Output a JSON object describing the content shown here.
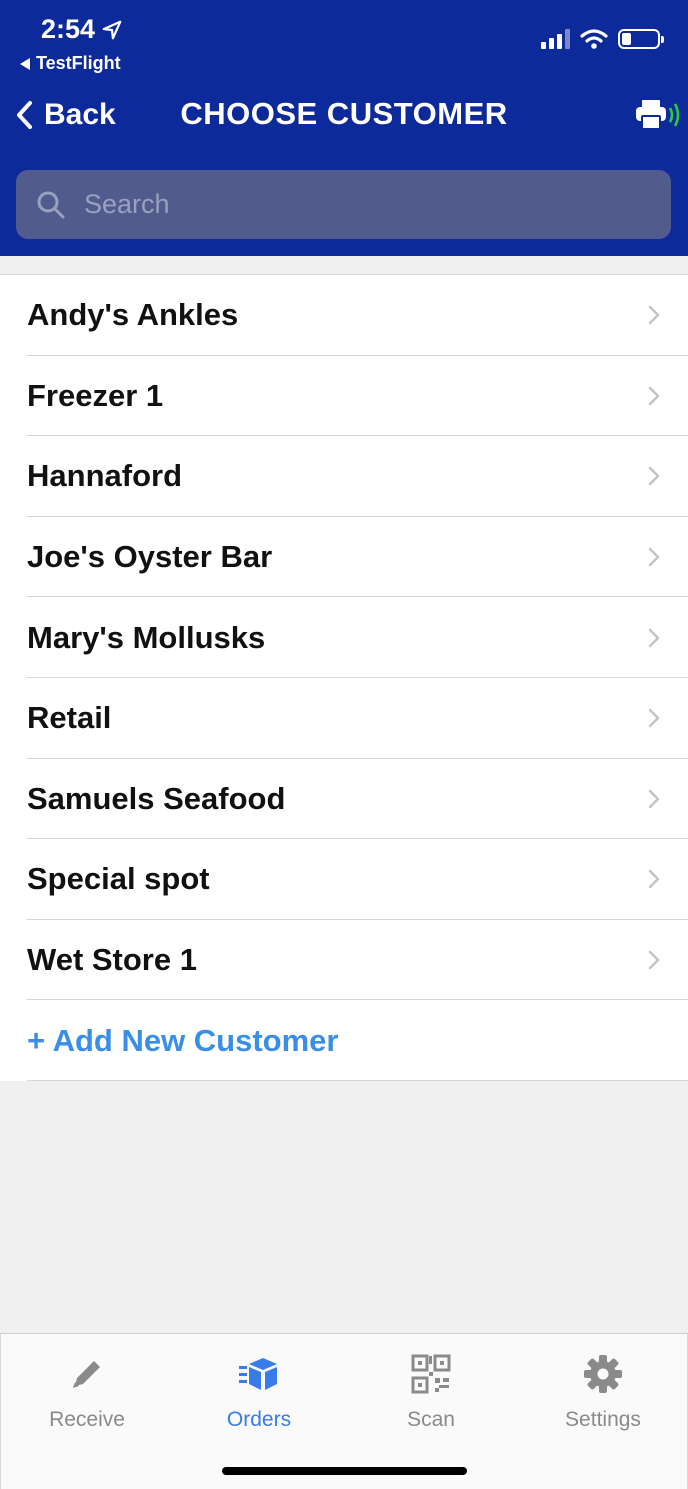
{
  "status": {
    "time": "2:54",
    "back_app": "TestFlight"
  },
  "nav": {
    "back_label": "Back",
    "title": "CHOOSE CUSTOMER"
  },
  "search": {
    "placeholder": "Search",
    "value": ""
  },
  "customers": [
    "Andy's Ankles",
    "Freezer 1",
    "Hannaford",
    "Joe's Oyster Bar",
    "Mary's Mollusks",
    "Retail",
    "Samuels Seafood",
    "Special spot",
    "Wet Store 1"
  ],
  "add_customer_label": "+ Add New Customer",
  "tabs": [
    {
      "label": "Receive",
      "icon": "pencil-icon",
      "active": false
    },
    {
      "label": "Orders",
      "icon": "orders-box-icon",
      "active": true
    },
    {
      "label": "Scan",
      "icon": "qr-code-icon",
      "active": false
    },
    {
      "label": "Settings",
      "icon": "gear-icon",
      "active": false
    }
  ],
  "colors": {
    "header_bg": "#0d2a9a",
    "accent": "#3a8ee6",
    "active_tab": "#3a7bea"
  }
}
